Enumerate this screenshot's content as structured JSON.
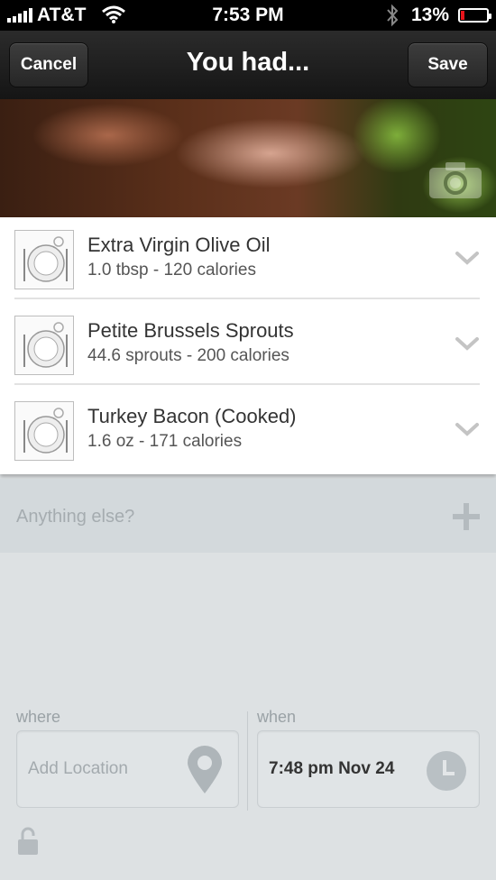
{
  "status_bar": {
    "carrier": "AT&T",
    "time": "7:53 PM",
    "battery": "13%",
    "battery_level": 0.13,
    "battery_color": "#e8141b"
  },
  "nav": {
    "title": "You had...",
    "cancel_label": "Cancel",
    "save_label": "Save"
  },
  "photo": {
    "camera_icon": "camera-icon"
  },
  "foods": [
    {
      "name": "Extra Virgin Olive Oil",
      "detail": "1.0 tbsp - 120 calories"
    },
    {
      "name": "Petite Brussels Sprouts",
      "detail": "44.6 sprouts - 200 calories"
    },
    {
      "name": "Turkey Bacon (Cooked)",
      "detail": "1.6 oz - 171 calories"
    }
  ],
  "add_more": {
    "placeholder": "Anything else?",
    "icon": "plus-icon"
  },
  "where": {
    "label": "where",
    "placeholder": "Add Location",
    "icon": "location-pin-icon"
  },
  "when": {
    "label": "when",
    "value": "7:48 pm Nov 24",
    "icon": "clock-icon"
  },
  "privacy": {
    "icon": "lock-icon"
  }
}
